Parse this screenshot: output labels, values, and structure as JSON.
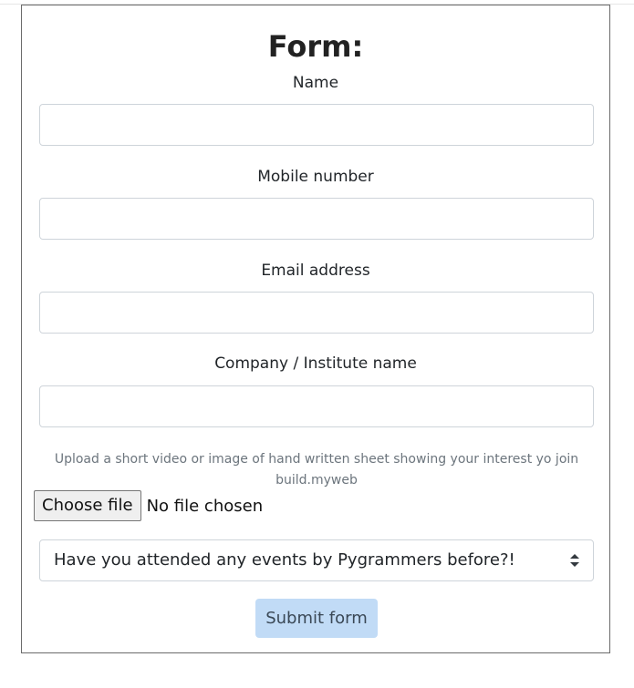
{
  "form": {
    "title": "Form:",
    "fields": [
      {
        "label": "Name",
        "value": "",
        "placeholder": ""
      },
      {
        "label": "Mobile number",
        "value": "",
        "placeholder": ""
      },
      {
        "label": "Email address",
        "value": "",
        "placeholder": ""
      },
      {
        "label": "Company / Institute name",
        "value": "",
        "placeholder": ""
      }
    ],
    "upload_help": "Upload a short video or image of hand written sheet showing your interest yo join build.myweb",
    "file_button_label": "Choose file",
    "file_status": "No file chosen",
    "select_value": "Have you attended any events by Pygrammers before?!",
    "select_icon": "sort-arrows-icon",
    "submit_label": "Submit form"
  },
  "colors": {
    "border": "#6b6b6b",
    "input_border": "#ced4da",
    "help_text": "#6c757d",
    "submit_bg": "#c1dbf6",
    "submit_text": "#3a4856"
  }
}
